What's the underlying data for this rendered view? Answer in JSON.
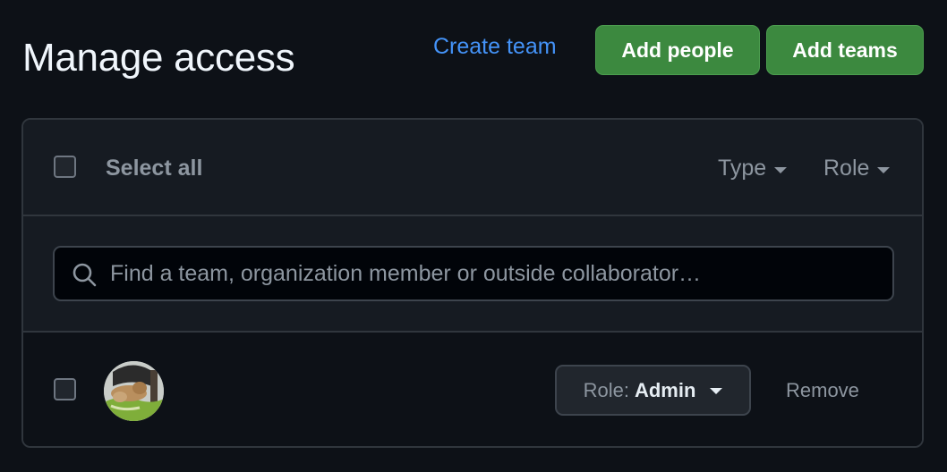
{
  "header": {
    "title": "Manage access",
    "create_team_label": "Create team",
    "add_people_label": "Add people",
    "add_teams_label": "Add teams"
  },
  "list_header": {
    "select_all_label": "Select all",
    "type_filter_label": "Type",
    "role_filter_label": "Role"
  },
  "search": {
    "placeholder": "Find a team, organization member or outside collaborator…",
    "value": ""
  },
  "members": [
    {
      "role_prefix": "Role:",
      "role_value": "Admin",
      "remove_label": "Remove"
    }
  ],
  "colors": {
    "background": "#0d1117",
    "panel": "#161b22",
    "border": "#30363d",
    "accent_link": "#4493f8",
    "button_green": "#3c893f",
    "muted_text": "#8d96a0"
  },
  "icons": [
    "search-icon",
    "chevron-down-icon",
    "avatar-image"
  ]
}
